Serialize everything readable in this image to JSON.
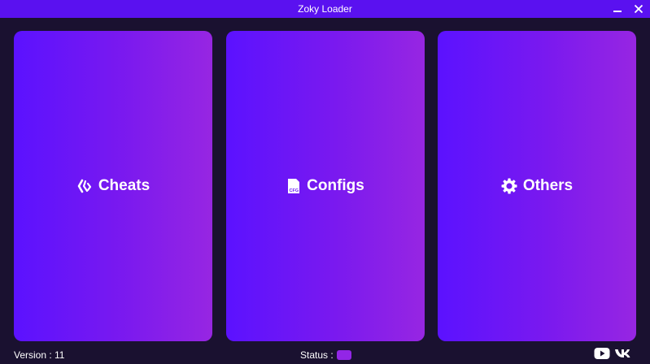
{
  "window": {
    "title": "Zoky Loader",
    "buttons": {
      "minimize_icon": "minimize-icon",
      "close_icon": "close-icon"
    }
  },
  "tiles": [
    {
      "label": "Cheats",
      "icon": "cheats-icon"
    },
    {
      "label": "Configs",
      "icon": "config-file-icon",
      "icon_text": "CFG"
    },
    {
      "label": "Others",
      "icon": "gear-icon"
    }
  ],
  "footer": {
    "version": "Version : 11",
    "status_label": "Status :",
    "status_color": "#9226e6",
    "social": [
      "youtube-icon",
      "vk-icon"
    ]
  },
  "colors": {
    "titlebar": "#5a11f0",
    "background": "#1a1130",
    "tile_gradient_start": "#5b12ff",
    "tile_gradient_end": "#9726e2"
  }
}
